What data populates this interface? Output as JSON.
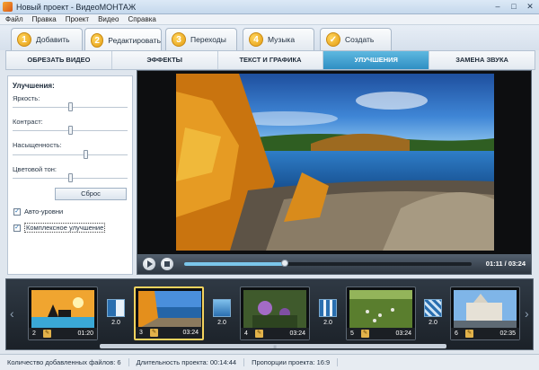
{
  "window": {
    "title": "Новый проект - ВидеоМОНТАЖ",
    "controls": [
      "–",
      "□",
      "✕"
    ]
  },
  "menu": [
    "Файл",
    "Правка",
    "Проект",
    "Видео",
    "Справка"
  ],
  "steps": [
    {
      "num": "1",
      "label": "Добавить"
    },
    {
      "num": "2",
      "label": "Редактировать",
      "active": true
    },
    {
      "num": "3",
      "label": "Переходы"
    },
    {
      "num": "4",
      "label": "Музыка"
    },
    {
      "num": "✓",
      "label": "Создать"
    }
  ],
  "subtabs": [
    "ОБРЕЗАТЬ ВИДЕО",
    "ЭФФЕКТЫ",
    "ТЕКСТ И ГРАФИКА",
    "УЛУЧШЕНИЯ",
    "ЗАМЕНА ЗВУКА"
  ],
  "active_subtab": "УЛУЧШЕНИЯ",
  "enhancements": {
    "title": "Улучшения:",
    "sliders": [
      {
        "label": "Яркость:",
        "value": 0.5
      },
      {
        "label": "Контраст:",
        "value": 0.5
      },
      {
        "label": "Насыщенность:",
        "value": 0.64
      },
      {
        "label": "Цветовой тон:",
        "value": 0.5
      }
    ],
    "reset_label": "Сброс",
    "checkboxes": [
      {
        "label": "Авто-уровни",
        "checked": true
      },
      {
        "label": "Комплексное улучшение",
        "checked": true
      }
    ]
  },
  "player": {
    "time": "01:11 / 03:24",
    "progress": 0.35
  },
  "timeline": {
    "clips": [
      {
        "num": "2",
        "duration": "01:20"
      },
      {
        "num": "3",
        "duration": "03:24",
        "active": true
      },
      {
        "num": "4",
        "duration": "03:24"
      },
      {
        "num": "5",
        "duration": "03:24"
      },
      {
        "num": "6",
        "duration": "02:35"
      }
    ],
    "transitions": [
      "2.0",
      "2.0",
      "2.0",
      "2.0",
      "2.0"
    ]
  },
  "status": {
    "files": "Количество добавленных файлов: 6",
    "duration": "Длительность проекта: 00:14:44",
    "ratio": "Пропорции проекта: 16:9"
  },
  "colors": {
    "accent": "#2f8fc3",
    "step_badge": "#e49c12",
    "active_clip_border": "#f4d35e"
  }
}
